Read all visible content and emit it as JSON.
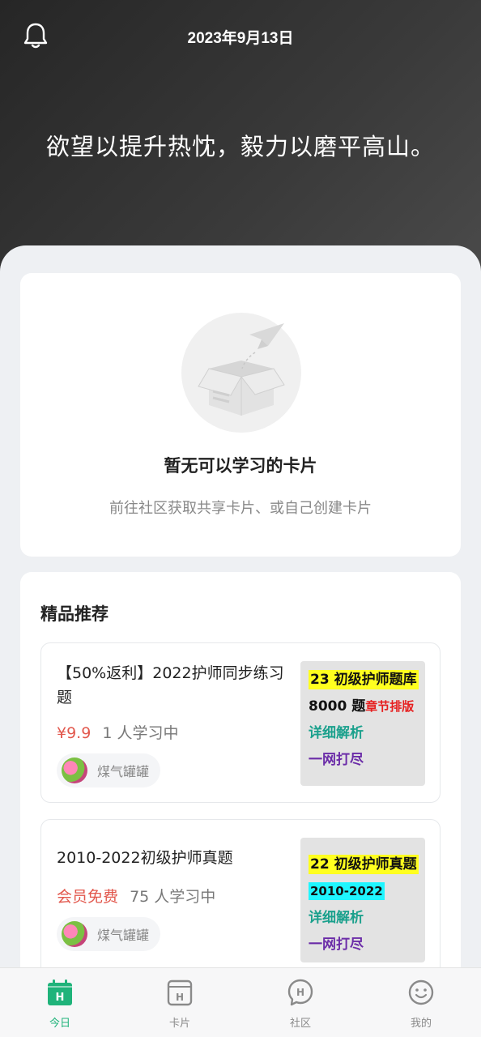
{
  "header": {
    "date": "2023年9月13日",
    "quote": "欲望以提升热忱，毅力以磨平高山。"
  },
  "empty_state": {
    "title": "暂无可以学习的卡片",
    "subtitle": "前往社区获取共享卡片、或自己创建卡片"
  },
  "recommend": {
    "title": "精品推荐",
    "courses": [
      {
        "title": "【50%返利】2022护师同步练习题",
        "price": "¥9.9",
        "learners": "1 人学习中",
        "author": "煤气罐罐",
        "cover": {
          "line1": "23 初级护师题库",
          "line2a": "8000 题",
          "line2b": "章节排版",
          "line3": "详细解析",
          "line4": "一网打尽"
        }
      },
      {
        "title": "2010-2022初级护师真题",
        "price": "会员免费",
        "learners": "75 人学习中",
        "author": "煤气罐罐",
        "cover": {
          "line1": "22 初级护师真题",
          "line2": "2010-2022",
          "line3": "详细解析",
          "line4": "一网打尽"
        }
      }
    ]
  },
  "tabs": [
    {
      "label": "今日",
      "icon": "calendar-icon",
      "active": true
    },
    {
      "label": "卡片",
      "icon": "card-box-icon",
      "active": false
    },
    {
      "label": "社区",
      "icon": "chat-bubble-icon",
      "active": false
    },
    {
      "label": "我的",
      "icon": "smiley-icon",
      "active": false
    }
  ],
  "colors": {
    "accent": "#1fb37a",
    "price": "#e2584d",
    "hero_bg": "#2e2e2e"
  }
}
